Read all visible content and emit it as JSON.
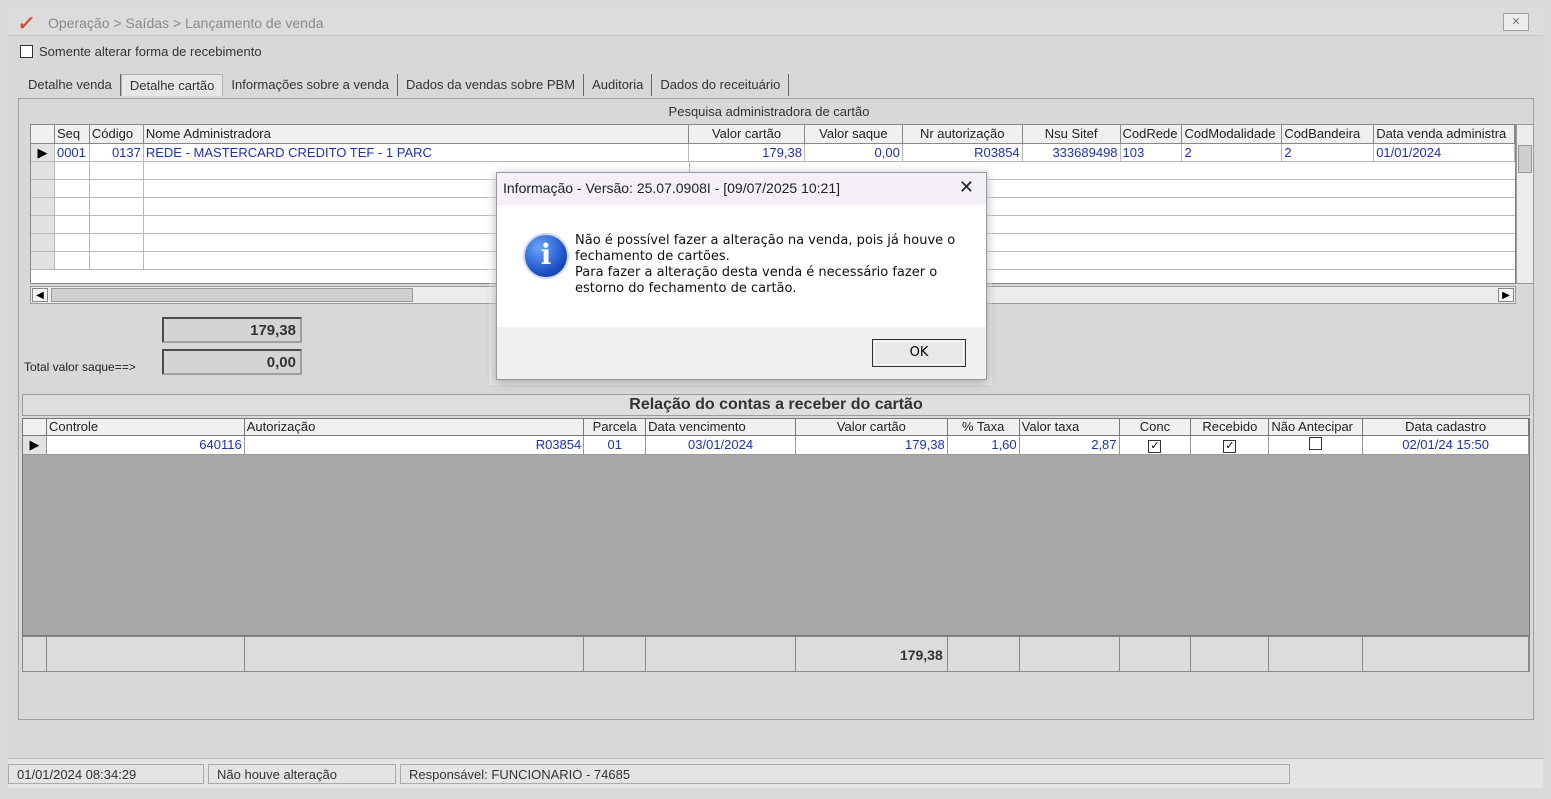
{
  "window": {
    "title": "Operação > Saídas > Lançamento de venda",
    "close_glyph": "✕"
  },
  "checkbox": {
    "label": "Somente alterar forma de recebimento"
  },
  "tabs": [
    {
      "label": "Detalhe venda"
    },
    {
      "label": "Detalhe cartão"
    },
    {
      "label": "Informações sobre a venda"
    },
    {
      "label": "Dados da vendas sobre PBM"
    },
    {
      "label": "Auditoria"
    },
    {
      "label": "Dados do receituário"
    }
  ],
  "card_grid": {
    "title": "Pesquisa administradora de cartão",
    "columns": [
      "Seq",
      "Código",
      "Nome Administradora",
      "Valor cartão",
      "Valor saque",
      "Nr autorização",
      "Nsu Sitef",
      "CodRede",
      "CodModalidade",
      "CodBandeira",
      "Data venda administra"
    ],
    "row": {
      "indicator": "▶",
      "seq": "0001",
      "codigo": "0137",
      "nome": "REDE - MASTERCARD CREDITO TEF - 1 PARC",
      "valor_cartao": "179,38",
      "valor_saque": "0,00",
      "nr_autorizacao": "R03854",
      "nsu_sitef": "333689498",
      "cod_rede": "103",
      "cod_modalidade": "2",
      "cod_bandeira": "2",
      "data_venda": "01/01/2024"
    },
    "scroll_left": "◀",
    "scroll_right": "▶"
  },
  "totals": {
    "valor_cartao": "179,38",
    "saque_label": "Total valor saque==>",
    "valor_saque": "0,00"
  },
  "receivables": {
    "title": "Relação do contas a receber do cartão",
    "columns": [
      "Controle",
      "Autorização",
      "Parcela",
      "Data vencimento",
      "Valor cartão",
      "% Taxa",
      "Valor taxa",
      "Conc",
      "Recebido",
      "Não Antecipar",
      "Data cadastro"
    ],
    "row": {
      "indicator": "▶",
      "controle": "640116",
      "autorizacao": "R03854",
      "parcela": "01",
      "data_vencimento": "03/01/2024",
      "valor_cartao": "179,38",
      "taxa_pct": "1,60",
      "valor_taxa": "2,87",
      "conc_mark": "✓",
      "recebido_mark": "✓",
      "data_cadastro": "02/01/24 15:50"
    },
    "footer_total": "179,38"
  },
  "status_bar": {
    "datetime": "01/01/2024 08:34:29",
    "state": "Não houve alteração",
    "responsavel": "Responsável: FUNCIONARIO - 74685"
  },
  "dialog": {
    "title": "Informação - Versão: 25.07.0908I - [09/07/2025 10:21]",
    "close_glyph": "✕",
    "icon_glyph": "i",
    "message_line1": "Não é possível fazer a alteração na venda, pois já houve o",
    "message_line2": "fechamento de cartões.",
    "message_line3": "Para fazer a alteração desta venda é necessário fazer o",
    "message_line4": "estorno do fechamento de cartão.",
    "ok_label": "OK"
  }
}
